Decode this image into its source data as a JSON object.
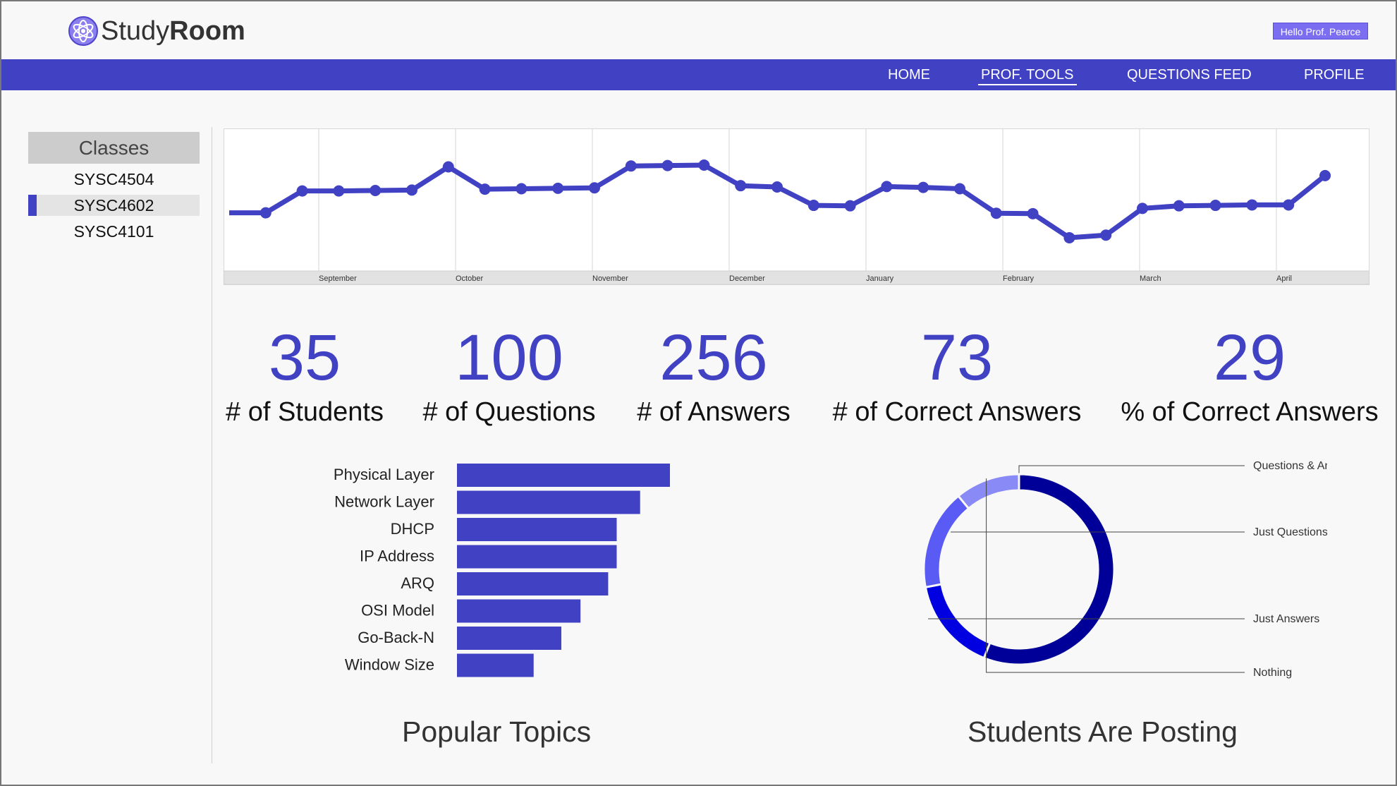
{
  "app": {
    "logo_plain": "Study",
    "logo_bold": "Room",
    "greeting": "Hello Prof. Pearce"
  },
  "nav": {
    "items": [
      {
        "label": "HOME",
        "active": false
      },
      {
        "label": "PROF. TOOLS",
        "active": true
      },
      {
        "label": "QUESTIONS FEED",
        "active": false
      },
      {
        "label": "PROFILE",
        "active": false
      }
    ]
  },
  "sidebar": {
    "title": "Classes",
    "items": [
      {
        "label": "SYSC4504",
        "active": false
      },
      {
        "label": "SYSC4602",
        "active": true
      },
      {
        "label": "SYSC4101",
        "active": false
      }
    ]
  },
  "stats": [
    {
      "value": "35",
      "label": "# of Students"
    },
    {
      "value": "100",
      "label": "# of Questions"
    },
    {
      "value": "256",
      "label": "# of Answers"
    },
    {
      "value": "73",
      "label": "# of Correct Answers"
    },
    {
      "value": "29",
      "label": "% of Correct Answers"
    }
  ],
  "colors": {
    "accent": "#4141c4",
    "nav_bg": "#4141c4",
    "donut": [
      "#000099",
      "#0000e0",
      "#5a5af5",
      "#8a8af7"
    ]
  },
  "chart_data": [
    {
      "type": "line",
      "title": "",
      "x_tick_labels": [
        "September",
        "October",
        "November",
        "December",
        "January",
        "February",
        "March",
        "April"
      ],
      "series": [
        {
          "values": [
            12,
            12,
            17,
            17,
            17.1,
            17.2,
            22.5,
            17.4,
            17.5,
            17.6,
            17.7,
            22.7,
            22.8,
            22.9,
            18.2,
            17.9,
            13.7,
            13.6,
            18,
            17.8,
            17.5,
            11.9,
            11.8,
            6.3,
            6.9,
            13,
            13.6,
            13.7,
            13.8,
            13.8,
            20.5
          ]
        }
      ],
      "ylim": [
        0,
        30
      ],
      "grid": true
    },
    {
      "type": "bar",
      "orientation": "horizontal",
      "title": "Popular Topics",
      "categories": [
        "Physical Layer",
        "Network Layer",
        "DHCP",
        "IP Address",
        "ARQ",
        "OSI Model",
        "Go-Back-N",
        "Window Size"
      ],
      "values": [
        100,
        86,
        75,
        75,
        71,
        58,
        49,
        36
      ]
    },
    {
      "type": "pie",
      "style": "donut",
      "title": "Students Are Posting",
      "categories": [
        "Questions & Answers",
        "Just Questions",
        "Just Answers",
        "Nothing"
      ],
      "values": [
        56,
        16,
        17,
        11
      ]
    }
  ]
}
